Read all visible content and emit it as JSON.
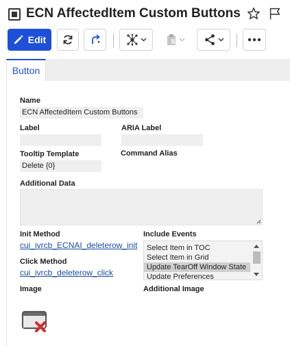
{
  "header": {
    "title": "ECN AffectedItem Custom Buttons"
  },
  "toolbar": {
    "edit_label": "Edit"
  },
  "tabs": [
    {
      "label": "Button"
    }
  ],
  "form": {
    "name": {
      "label": "Name",
      "value": "ECN AffectedItem Custom Buttons"
    },
    "label": {
      "label": "Label",
      "value": ""
    },
    "aria_label": {
      "label": "ARIA Label",
      "value": ""
    },
    "tooltip_template": {
      "label": "Tooltip Template",
      "value": "Delete {0}"
    },
    "command_alias": {
      "label": "Command Alias",
      "value": ""
    },
    "additional_data": {
      "label": "Additional Data",
      "value": ""
    },
    "init_method": {
      "label": "Init Method",
      "value": "cui_ivrcb_ECNAI_deleterow_init"
    },
    "click_method": {
      "label": "Click Method",
      "value": "cui_ivrcb_deleterow_click"
    },
    "include_events": {
      "label": "Include Events",
      "options": [
        "Select Item in TOC",
        "Select Item in Grid",
        "Update TearOff Window State",
        "Update Preferences"
      ],
      "selected": "Update TearOff Window State"
    },
    "image": {
      "label": "Image"
    },
    "additional_image": {
      "label": "Additional Image"
    }
  },
  "colors": {
    "accent": "#1d4fd8",
    "link": "#1a4fa0",
    "input_bg": "#efefef",
    "delete_x": "#d42b2b"
  },
  "icons": [
    "form-icon",
    "star-icon",
    "flag-icon",
    "pencil-icon",
    "refresh-icon",
    "redo-icon",
    "network-icon",
    "clipboard-icon",
    "share-icon",
    "more-icon",
    "window-delete-icon"
  ]
}
